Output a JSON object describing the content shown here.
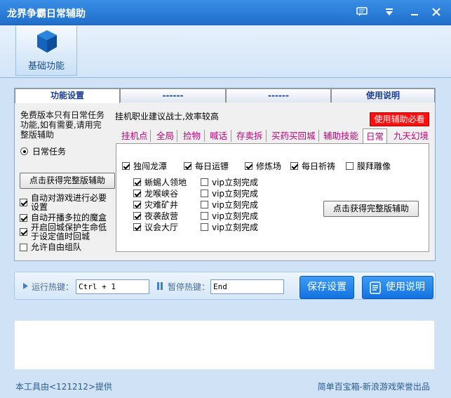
{
  "window": {
    "title": "龙界争霸日常辅助"
  },
  "toolbar": {
    "base_function_label": "基础功能"
  },
  "tabs": [
    {
      "label": "功能设置"
    },
    {
      "label": "------"
    },
    {
      "label": "------"
    },
    {
      "label": "使用说明"
    }
  ],
  "left": {
    "notice": "免费版本只有日常任务功能,如有需要,请用完整版辅助",
    "radio_label": "日常任务",
    "full_version_button": "点击获得完整版辅助",
    "options": [
      {
        "label": "自动对游戏进行必要设置",
        "checked": true
      },
      {
        "label": "自动开播多拉的魔盒",
        "checked": true
      },
      {
        "label": "开启回城保护生命低于设定值时回城",
        "checked": true
      },
      {
        "label": "允许自由组队",
        "checked": false
      }
    ]
  },
  "main": {
    "hint": "挂机职业建议战士,效率较高",
    "warn_button": "使用辅助必看",
    "subtabs": [
      "挂机点",
      "全局",
      "捡物",
      "喊话",
      "存卖拆",
      "买药买回城",
      "辅助技能",
      "日常",
      "九天幻境"
    ],
    "active_subtab": "日常",
    "top_checks": [
      {
        "label": "独闯龙潭",
        "checked": true
      },
      {
        "label": "每日运镖",
        "checked": true
      },
      {
        "label": "修炼场",
        "checked": true
      },
      {
        "label": "每日祈祷",
        "checked": true
      },
      {
        "label": "膜拜雕像",
        "checked": false
      }
    ],
    "dungeons": [
      {
        "label": "蜥蜴人领地",
        "checked": true,
        "vip": "vip立刻完成",
        "vip_checked": false
      },
      {
        "label": "龙喉峡谷",
        "checked": true,
        "vip": "vip立刻完成",
        "vip_checked": false
      },
      {
        "label": "灾难矿井",
        "checked": true,
        "vip": "vip立刻完成",
        "vip_checked": false
      },
      {
        "label": "夜袭敌营",
        "checked": true,
        "vip": "vip立刻完成",
        "vip_checked": false
      },
      {
        "label": "议会大厅",
        "checked": true,
        "vip": "vip立刻完成",
        "vip_checked": false
      }
    ],
    "full_version_button": "点击获得完整版辅助"
  },
  "hotkeys": {
    "run_label": "运行热键：",
    "run_value": "Ctrl + 1",
    "pause_label": "暂停热键：",
    "pause_value": "End",
    "save_button": "保存设置",
    "help_button": "使用说明"
  },
  "footer": {
    "left": "本工具由<121212>提供",
    "right": "简单百宝箱-新浪游戏荣誉出品"
  },
  "colors": {
    "titlebar": "#2a7fdc",
    "accent_blue": "#1a78e6",
    "warn_red": "#ff1010",
    "subtab_magenta": "#c0007a"
  }
}
